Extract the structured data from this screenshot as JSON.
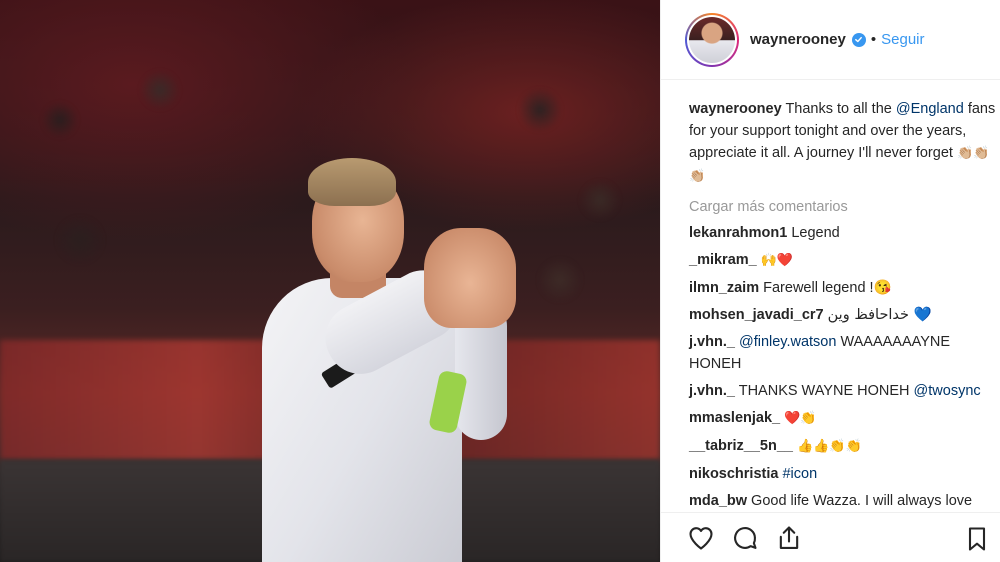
{
  "post": {
    "username": "waynerooney",
    "follow_label": "Seguir",
    "dot": "•",
    "caption": {
      "user": "waynerooney",
      "text_1": " Thanks to all the ",
      "mention": "@England",
      "text_2": " fans for your support tonight and over the years, appreciate it all. A journey I'll never forget ",
      "emoji": "👏🏼👏🏼👏🏼"
    },
    "load_more_label": "Cargar más comentarios",
    "comments": [
      {
        "user": "lekanrahmon1",
        "text": "Legend"
      },
      {
        "user": "_mikram_",
        "text": "🙌❤️"
      },
      {
        "user": "ilmn_zaim",
        "text": "Farewell legend !😘"
      },
      {
        "user": "mohsen_javadi_cr7",
        "text": "خداحافظ وین 💙"
      },
      {
        "user": "j.vhn._",
        "mention": "@finley.watson",
        "text": "WAAAAAAAYNE HONEH"
      },
      {
        "user": "j.vhn._",
        "text": "THANKS WAYNE HONEH",
        "mention_after": "@twosync"
      },
      {
        "user": "mmaslenjak_",
        "text": "❤️👏"
      },
      {
        "user": "__tabriz__5n__",
        "text": "👍👍👏👏"
      },
      {
        "user": "nikoschristia",
        "hashtag": "#icon"
      },
      {
        "user": "mda_bw",
        "text": "Good life Wazza. I will always love"
      }
    ]
  },
  "icons": {
    "verified": "verified-badge-icon",
    "like": "heart-icon",
    "comment": "comment-bubble-icon",
    "share": "share-icon",
    "save": "bookmark-icon"
  },
  "colors": {
    "link_blue": "#3897f0",
    "mention_blue": "#003569",
    "muted_gray": "#999999",
    "text": "#262626"
  }
}
